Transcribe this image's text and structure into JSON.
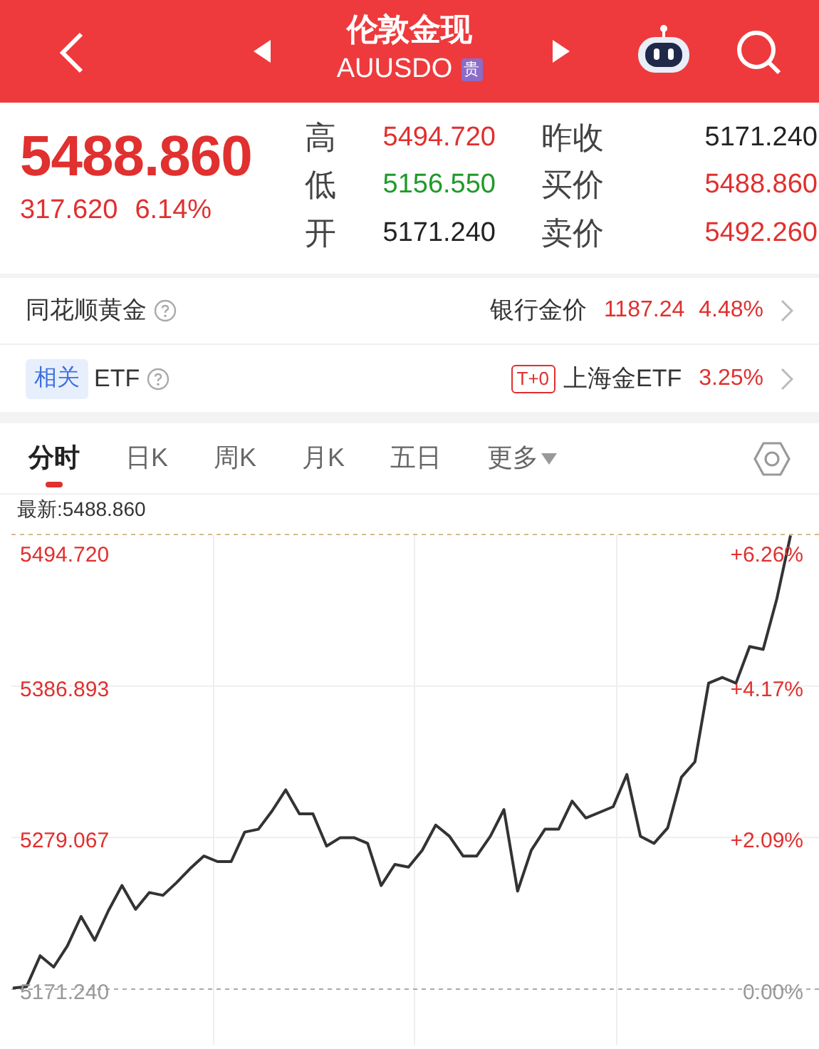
{
  "header": {
    "title": "伦敦金现",
    "symbol": "AUUSDO",
    "badge": "贵"
  },
  "quote": {
    "price": "5488.860",
    "change": "317.620",
    "change_pct": "6.14%",
    "fields": [
      {
        "label": "高",
        "value": "5494.720",
        "color": "#e0302f"
      },
      {
        "label": "昨收",
        "value": "5171.240",
        "color": "#222222"
      },
      {
        "label": "低",
        "value": "5156.550",
        "color": "#1f9a2a"
      },
      {
        "label": "买价",
        "value": "5488.860",
        "color": "#e0302f"
      },
      {
        "label": "开",
        "value": "5171.240",
        "color": "#222222"
      },
      {
        "label": "卖价",
        "value": "5492.260",
        "color": "#e0302f"
      }
    ]
  },
  "gold_row": {
    "label": "同花顺黄金",
    "right_label": "银行金价",
    "value": "1187.24",
    "pct": "4.48%"
  },
  "etf_row": {
    "tag": "相关",
    "label": "ETF",
    "badge": "T+0",
    "right_label": "上海金ETF",
    "pct": "3.25%"
  },
  "tabs": [
    {
      "label": "分时",
      "selected": true,
      "kind": "plain"
    },
    {
      "label": "日K",
      "selected": false,
      "kind": "plain"
    },
    {
      "label": "周K",
      "selected": false,
      "kind": "plain"
    },
    {
      "label": "月K",
      "selected": false,
      "kind": "plain"
    },
    {
      "label": "五日",
      "selected": false,
      "kind": "plain"
    },
    {
      "label": "更多",
      "selected": false,
      "kind": "dropdown"
    }
  ],
  "chart": {
    "latest": "最新:5488.860",
    "chart_data": {
      "type": "line",
      "ylim": [
        5171.24,
        5494.72
      ],
      "y2lim": [
        0,
        6.26
      ],
      "yticks": [
        {
          "value": 5494.72,
          "label": "5494.720"
        },
        {
          "value": 5386.893,
          "label": "5386.893"
        },
        {
          "value": 5279.067,
          "label": "5279.067"
        },
        {
          "value": 5171.24,
          "label": "5171.240"
        }
      ],
      "y2ticks": [
        {
          "value": 6.26,
          "label": "+6.26%"
        },
        {
          "value": 4.17,
          "label": "+4.17%"
        },
        {
          "value": 2.09,
          "label": "+2.09%"
        },
        {
          "value": 0,
          "label": "0.00%"
        }
      ],
      "series": [
        {
          "color": "#333333",
          "values": [
            5172,
            5173,
            5195,
            5187,
            5202,
            5223,
            5206,
            5227,
            5245,
            5228,
            5240,
            5238,
            5247,
            5257,
            5266,
            5262,
            5262,
            5283,
            5285,
            5298,
            5313,
            5296,
            5296,
            5273,
            5279,
            5279,
            5275,
            5245,
            5260,
            5258,
            5270,
            5288,
            5280,
            5266,
            5266,
            5280,
            5299,
            5241,
            5270,
            5285,
            5285,
            5305,
            5293,
            5297,
            5301,
            5324,
            5280,
            5275,
            5286,
            5322,
            5333,
            5389,
            5393,
            5389,
            5415,
            5413,
            5449,
            5494
          ]
        }
      ]
    }
  }
}
